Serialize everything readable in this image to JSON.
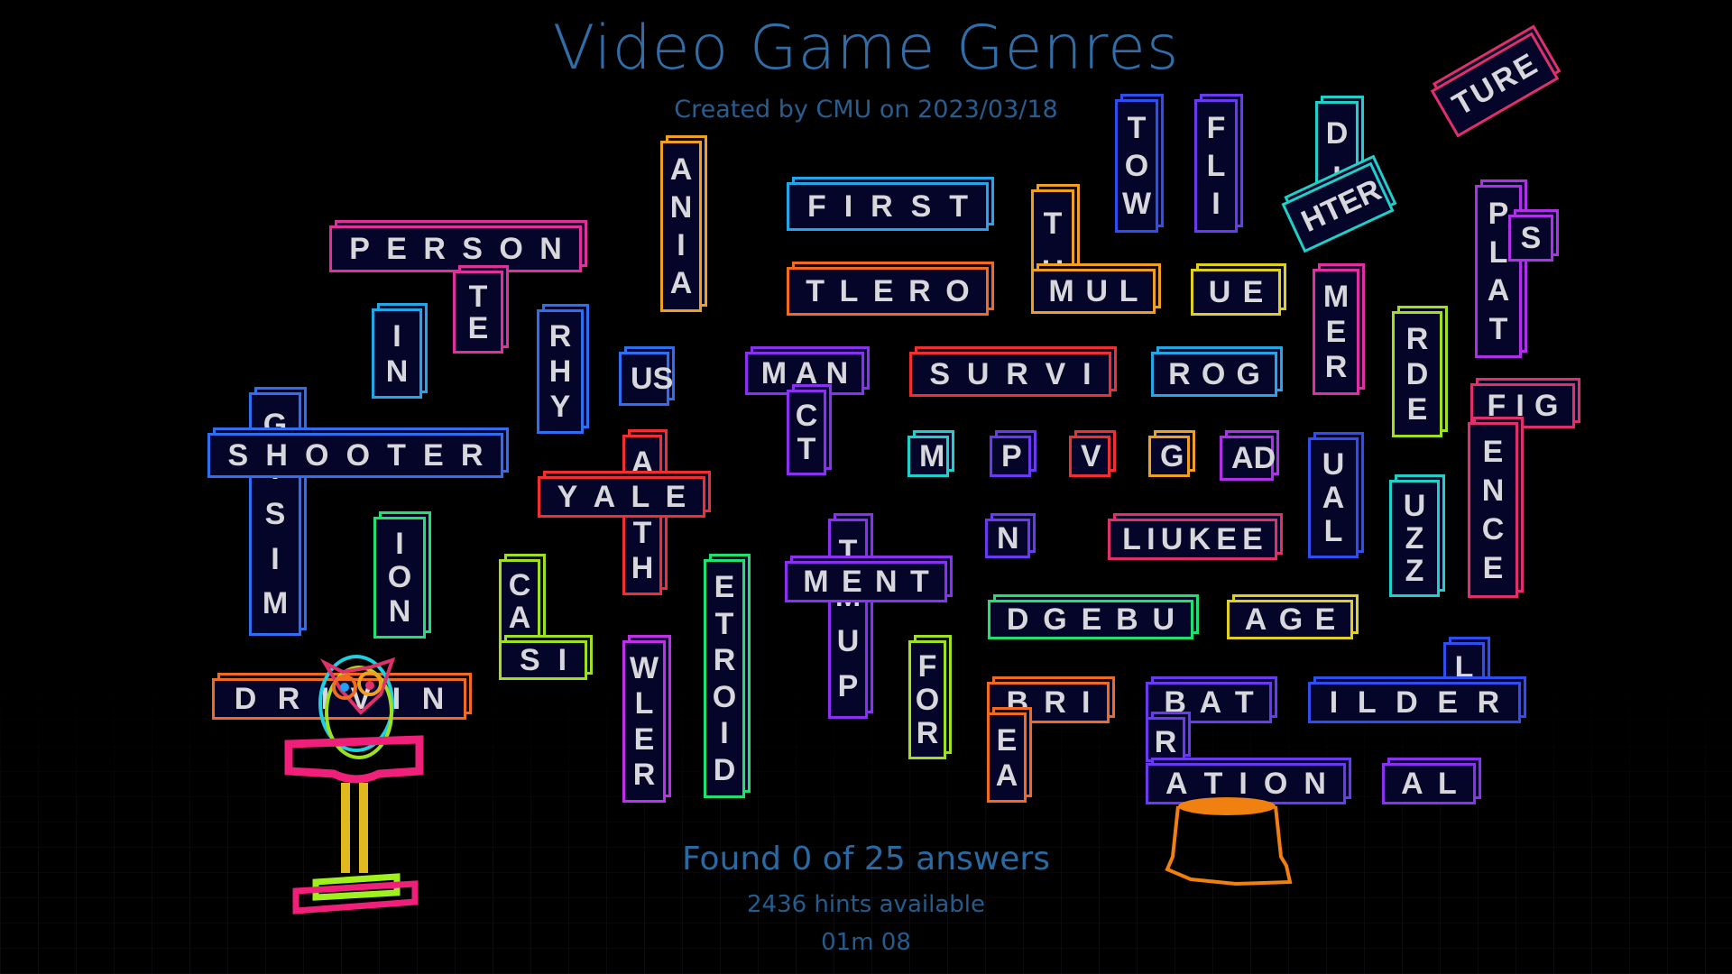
{
  "header": {
    "title": "Video Game Genres",
    "subtitle": "Created by CMU on 2023/03/18"
  },
  "status": {
    "found_text": "Found 0 of 25 answers",
    "found": 0,
    "total": 25,
    "hints_text": "2436 hints available",
    "timer": "01m 08"
  },
  "icons": {
    "owl": "owl-mascot-icon",
    "stump": "tree-stump-icon"
  },
  "tiles": [
    {
      "id": "person",
      "text": "PERSON",
      "color": "#e0309a"
    },
    {
      "id": "te",
      "text": "TE",
      "color": "#e0309a"
    },
    {
      "id": "in",
      "text": "IN",
      "color": "#22a6e6"
    },
    {
      "id": "rhy",
      "text": "RHY",
      "color": "#2f6ef0"
    },
    {
      "id": "ania",
      "text": "ANIA",
      "color": "#f0a020"
    },
    {
      "id": "first",
      "text": "FIRST",
      "color": "#22a6e6"
    },
    {
      "id": "tlero",
      "text": "TLERO",
      "color": "#f06a20"
    },
    {
      "id": "th",
      "text": "TH",
      "color": "#f0a020"
    },
    {
      "id": "mul",
      "text": "MUL",
      "color": "#f0a020"
    },
    {
      "id": "tow",
      "text": "TOW",
      "color": "#2f4ef0"
    },
    {
      "id": "fli",
      "text": "FLI",
      "color": "#6a3af0"
    },
    {
      "id": "ue",
      "text": "UE",
      "color": "#e0d020"
    },
    {
      "id": "di",
      "text": "DI",
      "color": "#20d0c8"
    },
    {
      "id": "hter",
      "text": "HTER",
      "color": "#20d0c8"
    },
    {
      "id": "ture",
      "text": "TURE",
      "color": "#e0306a"
    },
    {
      "id": "mer",
      "text": "MER",
      "color": "#e030a0"
    },
    {
      "id": "pilat",
      "text": "PLAT",
      "color": "#b030e8"
    },
    {
      "id": "s",
      "text": "S",
      "color": "#b030e8"
    },
    {
      "id": "rde",
      "text": "RDE",
      "color": "#a0e020"
    },
    {
      "id": "us",
      "text": "US",
      "color": "#2f6ef0"
    },
    {
      "id": "man",
      "text": "MAN",
      "color": "#8a30f0"
    },
    {
      "id": "ct",
      "text": "CT",
      "color": "#8a30f0"
    },
    {
      "id": "survi",
      "text": "SURVI",
      "color": "#f03030"
    },
    {
      "id": "rog",
      "text": "ROG",
      "color": "#22a6e6"
    },
    {
      "id": "gtsim",
      "text": "GTSIM",
      "color": "#2f6ef0"
    },
    {
      "id": "shooter",
      "text": "SHOOTER",
      "color": "#2f6ef0"
    },
    {
      "id": "alth",
      "text": "ALTH",
      "color": "#f03030"
    },
    {
      "id": "yale",
      "text": "YALE",
      "color": "#f03030"
    },
    {
      "id": "m",
      "text": "M",
      "color": "#20d0c8"
    },
    {
      "id": "p",
      "text": "P",
      "color": "#6a3af0"
    },
    {
      "id": "v",
      "text": "V",
      "color": "#f03030"
    },
    {
      "id": "g",
      "text": "G",
      "color": "#f0a020"
    },
    {
      "id": "ad",
      "text": "AD",
      "color": "#b030e8"
    },
    {
      "id": "ual",
      "text": "UAL",
      "color": "#2f4ef0"
    },
    {
      "id": "fig",
      "text": "FIG",
      "color": "#e0306a"
    },
    {
      "id": "ence",
      "text": "ENCE",
      "color": "#e0306a"
    },
    {
      "id": "uzz",
      "text": "UZZ",
      "color": "#20d0c8"
    },
    {
      "id": "ion",
      "text": "ION",
      "color": "#20e070"
    },
    {
      "id": "n",
      "text": "N",
      "color": "#6a3af0"
    },
    {
      "id": "like",
      "text": "L IUKEE",
      "color": "#e0306a"
    },
    {
      "id": "cas",
      "text": "CAS",
      "color": "#a0e020"
    },
    {
      "id": "si",
      "text": "SI",
      "color": "#a0e020"
    },
    {
      "id": "etroid",
      "text": "ETROID",
      "color": "#20e070"
    },
    {
      "id": "tmup",
      "text": "TMUP",
      "color": "#8a30f0"
    },
    {
      "id": "ment",
      "text": "MENT",
      "color": "#8a30f0"
    },
    {
      "id": "dgebu",
      "text": "DGEBU",
      "color": "#20e070"
    },
    {
      "id": "age",
      "text": "AGE",
      "color": "#e0d020"
    },
    {
      "id": "drivin",
      "text": "DRIVIN",
      "color": "#f06a20"
    },
    {
      "id": "wler",
      "text": "WLER",
      "color": "#c030e8"
    },
    {
      "id": "for",
      "text": "FOR",
      "color": "#a0e020"
    },
    {
      "id": "bri",
      "text": "BRI",
      "color": "#f06a20"
    },
    {
      "id": "ea",
      "text": "EA",
      "color": "#f06a20"
    },
    {
      "id": "bat",
      "text": "BAT",
      "color": "#6a3af0"
    },
    {
      "id": "r",
      "text": "R",
      "color": "#6a3af0"
    },
    {
      "id": "ation",
      "text": "ATION",
      "color": "#6a3af0"
    },
    {
      "id": "l",
      "text": "L",
      "color": "#2f4ef0"
    },
    {
      "id": "ilder",
      "text": "ILDER",
      "color": "#2f4ef0"
    },
    {
      "id": "al",
      "text": "AL",
      "color": "#8a30f0"
    }
  ]
}
